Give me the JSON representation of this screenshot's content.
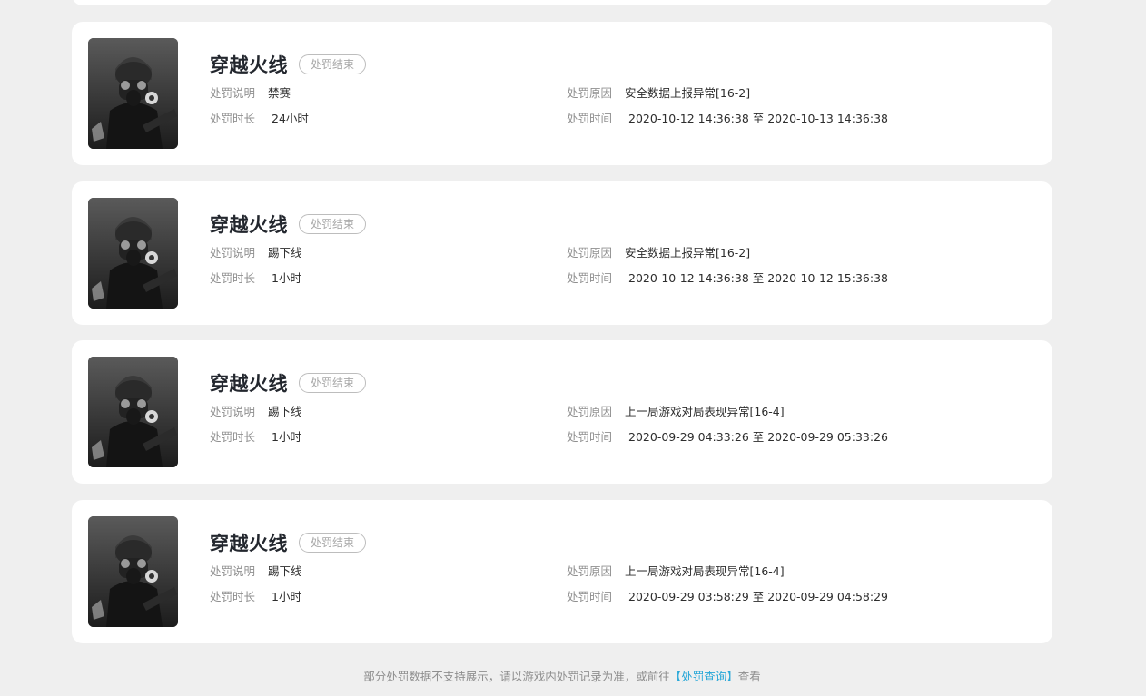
{
  "records": [
    {
      "game_name": "穿越火线",
      "status": "处罚结束",
      "desc_label": "处罚说明",
      "desc_value": "禁赛",
      "duration_label": "处罚时长",
      "duration_value": "24小时",
      "reason_label": "处罚原因",
      "reason_value": "安全数据上报异常[16-2]",
      "time_label": "处罚时间",
      "time_value": "2020-10-12 14:36:38 至 2020-10-13 14:36:38"
    },
    {
      "game_name": "穿越火线",
      "status": "处罚结束",
      "desc_label": "处罚说明",
      "desc_value": "踢下线",
      "duration_label": "处罚时长",
      "duration_value": "1小时",
      "reason_label": "处罚原因",
      "reason_value": "安全数据上报异常[16-2]",
      "time_label": "处罚时间",
      "time_value": "2020-10-12 14:36:38 至 2020-10-12 15:36:38"
    },
    {
      "game_name": "穿越火线",
      "status": "处罚结束",
      "desc_label": "处罚说明",
      "desc_value": "踢下线",
      "duration_label": "处罚时长",
      "duration_value": "1小时",
      "reason_label": "处罚原因",
      "reason_value": "上一局游戏对局表现异常[16-4]",
      "time_label": "处罚时间",
      "time_value": "2020-09-29 04:33:26 至 2020-09-29 05:33:26"
    },
    {
      "game_name": "穿越火线",
      "status": "处罚结束",
      "desc_label": "处罚说明",
      "desc_value": "踢下线",
      "duration_label": "处罚时长",
      "duration_value": "1小时",
      "reason_label": "处罚原因",
      "reason_value": "上一局游戏对局表现异常[16-4]",
      "time_label": "处罚时间",
      "time_value": "2020-09-29 03:58:29 至 2020-09-29 04:58:29"
    }
  ],
  "footer": {
    "text_before": "部分处罚数据不支持展示，请以游戏内处罚记录为准，或前往",
    "link_text": "【处罚查询】",
    "text_after": "查看"
  }
}
